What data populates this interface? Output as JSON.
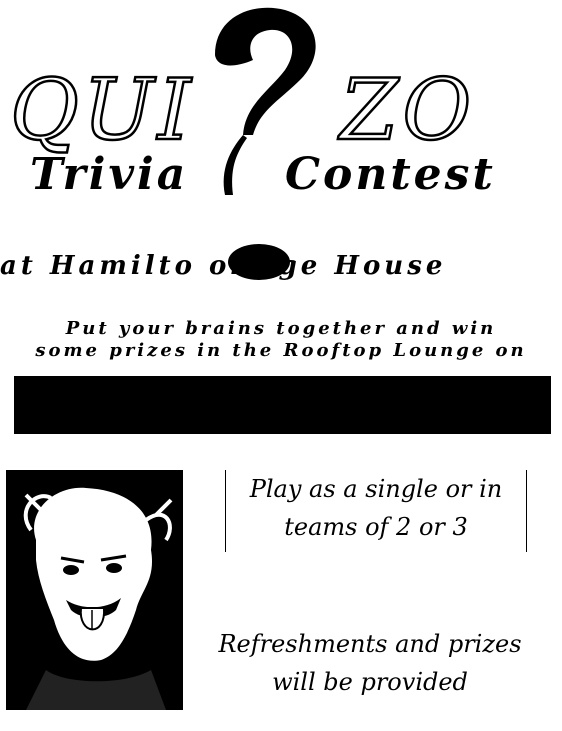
{
  "flyer": {
    "title": "QUIZZO",
    "title_left": "QUI",
    "title_right": "ZO",
    "subtitle_left": "Trivia",
    "subtitle_right": "Contest",
    "venue": "at Hamilto   ollege House",
    "tagline_line1": "Put your brains together and win",
    "tagline_line2": "some prizes in the Rooftop Lounge on",
    "info_line1": "Play as a single or in",
    "info_line2": "teams of 2 or 3",
    "refresh_line1": "Refreshments and prizes",
    "refresh_line2": "will be provided"
  },
  "colors": {
    "ink": "#000000",
    "paper": "#ffffff"
  },
  "icons": {
    "question_mark": "question-mark-graphic",
    "portrait": "einstein-tongue-photo"
  }
}
